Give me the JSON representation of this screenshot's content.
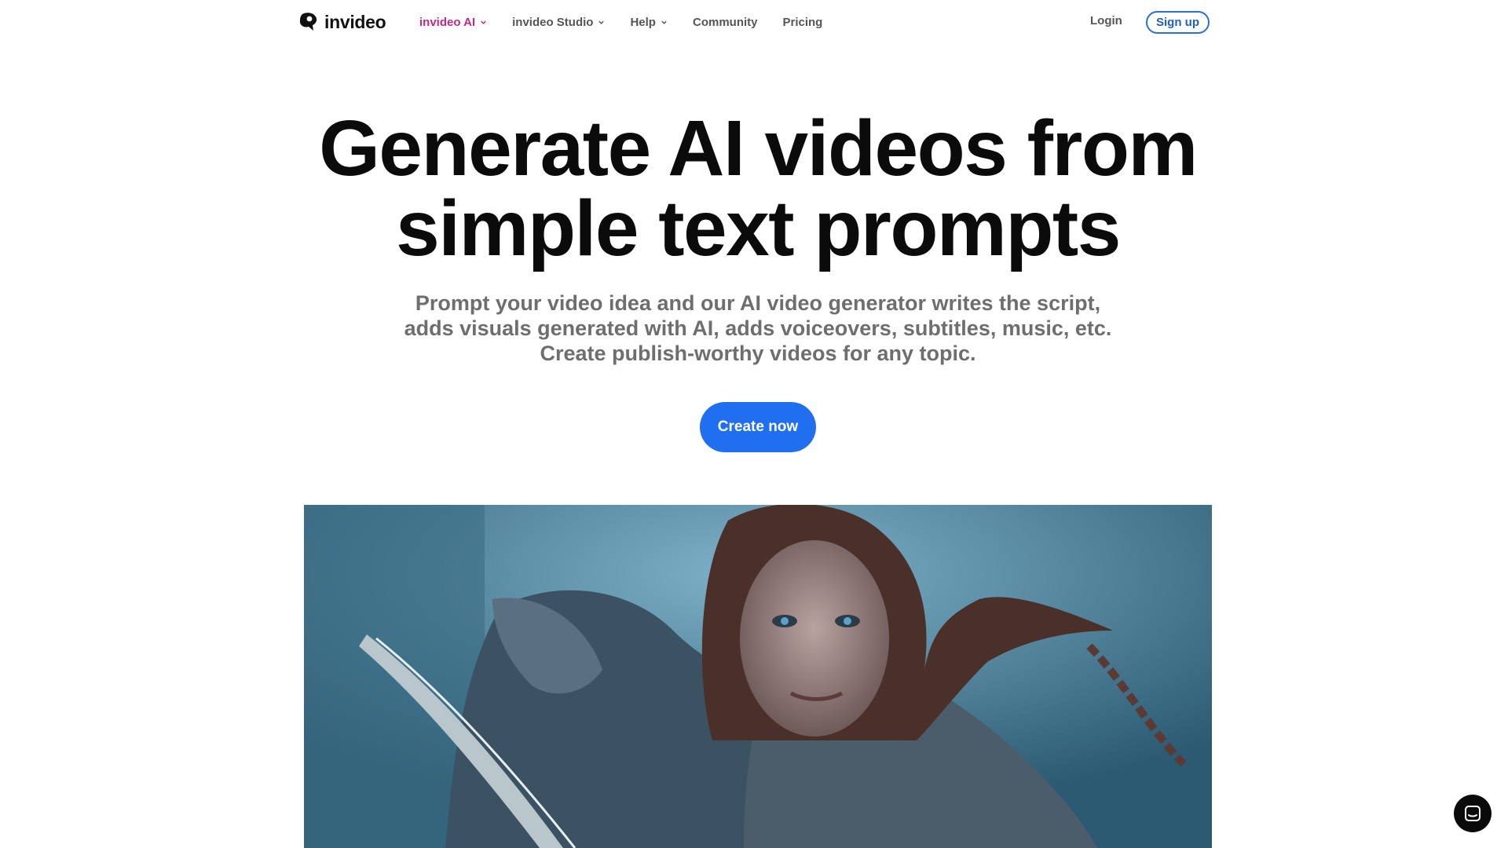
{
  "brand": {
    "name": "invideo",
    "logo_icon": "invideo-logo-icon"
  },
  "nav": {
    "items": [
      {
        "label": "invideo AI",
        "dropdown": true,
        "active": true
      },
      {
        "label": "invideo Studio",
        "dropdown": true,
        "active": false
      },
      {
        "label": "Help",
        "dropdown": true,
        "active": false
      },
      {
        "label": "Community",
        "dropdown": false,
        "active": false
      },
      {
        "label": "Pricing",
        "dropdown": false,
        "active": false
      }
    ],
    "login_label": "Login",
    "signup_label": "Sign up"
  },
  "hero": {
    "title_line1": "Generate AI videos from",
    "title_line2": "simple text prompts",
    "subtitle_line1": "Prompt your video idea and our AI video generator writes the script,",
    "subtitle_line2": "adds visuals generated with AI, adds voiceovers, subtitles, music, etc.",
    "subtitle_line3": "Create publish-worthy videos for any topic.",
    "cta_label": "Create now"
  },
  "media": {
    "icon": "video-preview-image"
  },
  "chat_widget": {
    "icon": "chat-icon"
  },
  "colors": {
    "accent_active": "#c02a84",
    "primary_blue": "#1f6ff0",
    "signup_border": "#2a6fd6"
  }
}
